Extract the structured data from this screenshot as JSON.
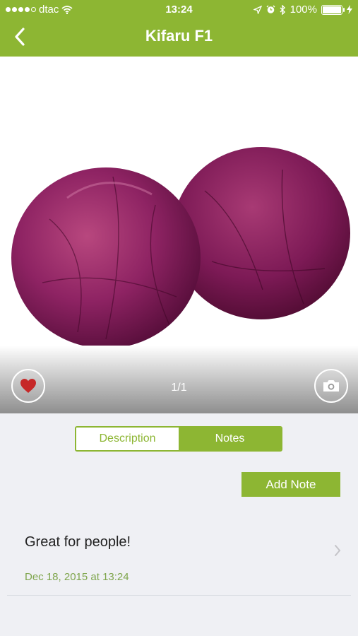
{
  "status_bar": {
    "carrier": "dtac",
    "time": "13:24",
    "battery": "100%",
    "signal_icon": "signal-dots-icon",
    "wifi_icon": "wifi-icon",
    "location_icon": "location-arrow-icon",
    "alarm_icon": "alarm-clock-icon",
    "bluetooth_icon": "bluetooth-icon",
    "battery_icon": "battery-full-icon",
    "charging_icon": "lightning-bolt-icon"
  },
  "nav": {
    "title": "Kifaru F1",
    "back_icon": "chevron-left-icon"
  },
  "gallery": {
    "image_subject": "red cabbage",
    "counter": "1/1",
    "favorite_icon": "heart-icon",
    "camera_icon": "camera-icon"
  },
  "tabs": [
    {
      "label": "Description",
      "selected": false
    },
    {
      "label": "Notes",
      "selected": true
    }
  ],
  "actions": {
    "add_note_label": "Add Note"
  },
  "notes": [
    {
      "text": "Great for people!",
      "date": "Dec 18, 2015 at 13:24"
    }
  ],
  "colors": {
    "accent": "#8db633",
    "background": "#eff0f4",
    "date_text": "#7ea54c",
    "heart": "#c62828"
  }
}
